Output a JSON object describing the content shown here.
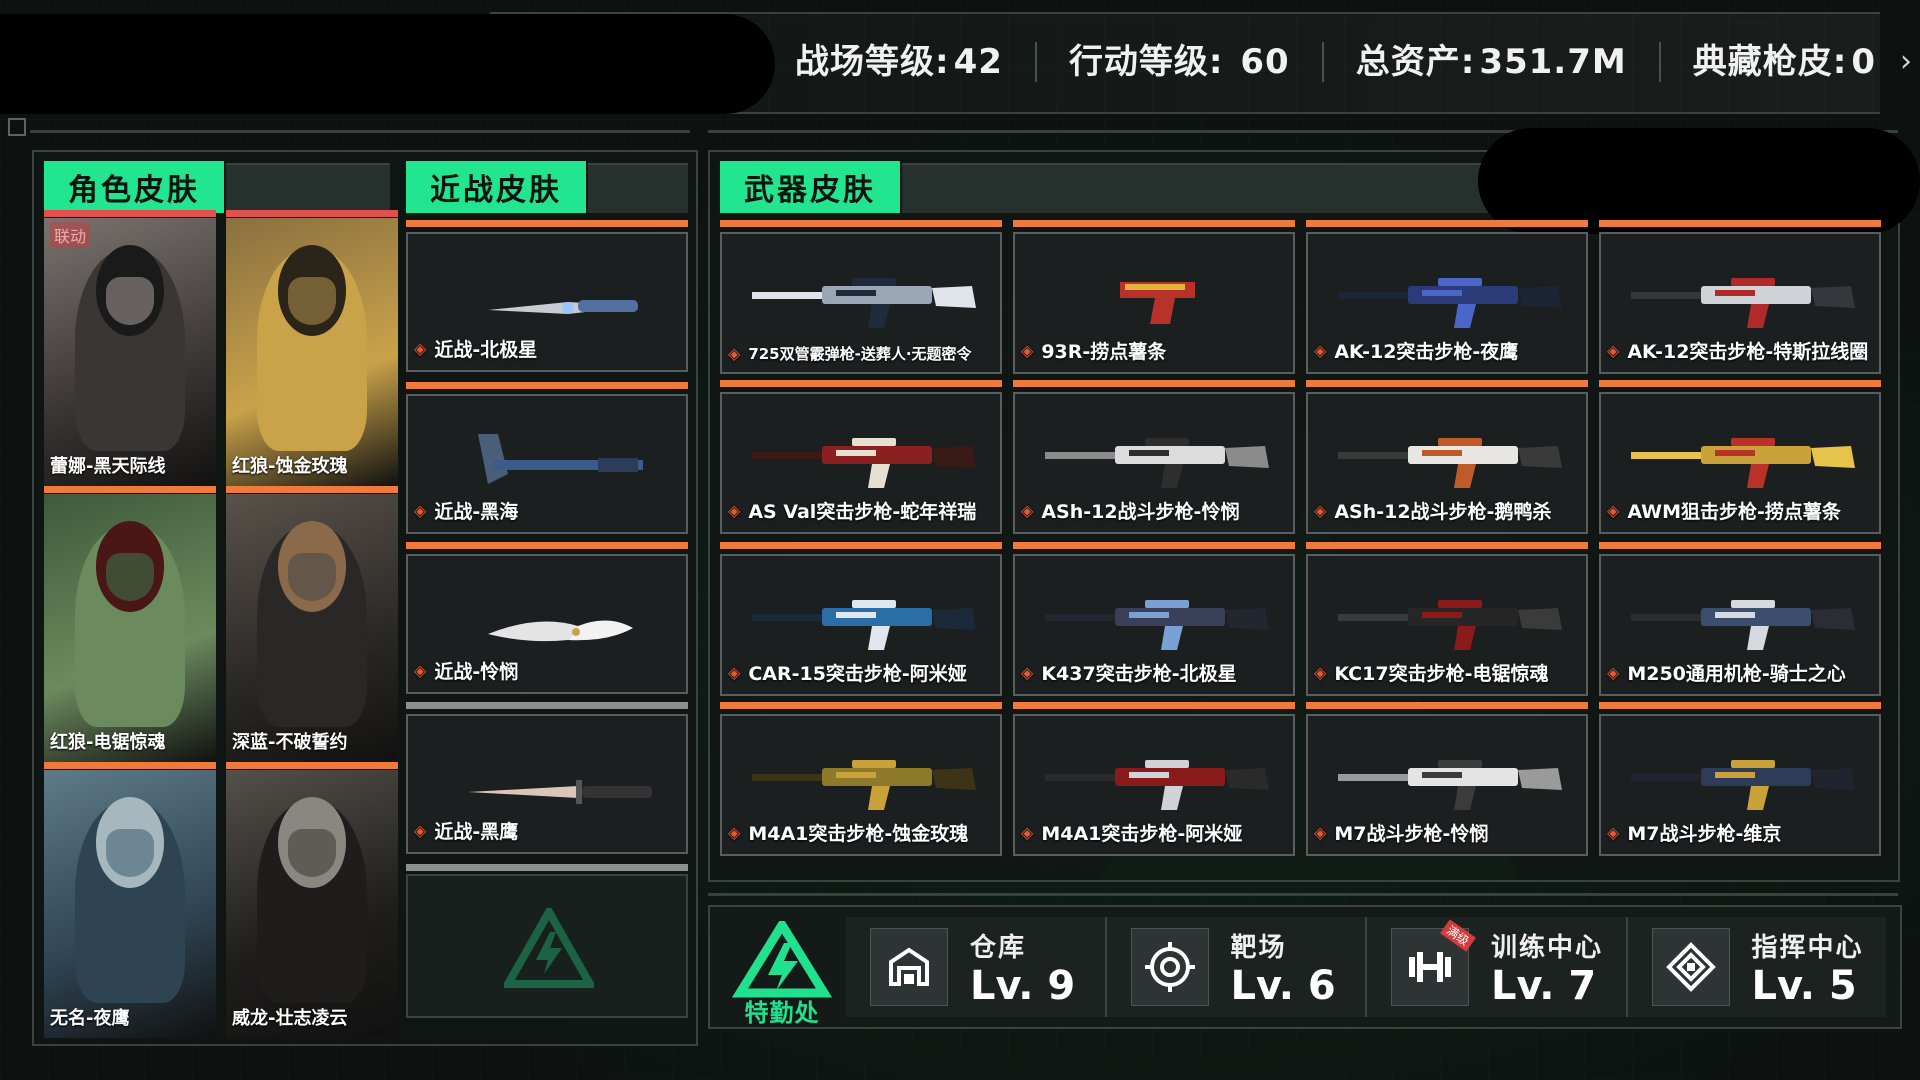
{
  "header": {
    "stats": [
      {
        "label": "战场等级:",
        "value": "42"
      },
      {
        "label": "行动等级: ",
        "value": "60"
      },
      {
        "label": "总资产:",
        "value": "351.7M"
      },
      {
        "label": "典藏枪皮:",
        "value": "0"
      }
    ]
  },
  "tabs": {
    "character": "角色皮肤",
    "melee": "近战皮肤",
    "weapon": "武器皮肤"
  },
  "character_skins": [
    {
      "name": "蕾娜-黑天际线",
      "badge": "联动"
    },
    {
      "name": "红狼-蚀金玫瑰"
    },
    {
      "name": "红狼-电锯惊魂"
    },
    {
      "name": "深蓝-不破誓约"
    },
    {
      "name": "无名-夜鹰"
    },
    {
      "name": "威龙-壮志凌云"
    }
  ],
  "melee_skins": [
    {
      "name": "近战-北极星"
    },
    {
      "name": "近战-黑海"
    },
    {
      "name": "近战-怜悯"
    },
    {
      "name": "近战-黑鹰"
    }
  ],
  "weapon_skins": [
    {
      "name": "725双管霰弹枪-送葬人·无题密令"
    },
    {
      "name": "93R-捞点薯条"
    },
    {
      "name": "AK-12突击步枪-夜鹰"
    },
    {
      "name": "AK-12突击步枪-特斯拉线圈"
    },
    {
      "name": "AS Val突击步枪-蛇年祥瑞"
    },
    {
      "name": "ASh-12战斗步枪-怜悯"
    },
    {
      "name": "ASh-12战斗步枪-鹅鸭杀"
    },
    {
      "name": "AWM狙击步枪-捞点薯条"
    },
    {
      "name": "CAR-15突击步枪-阿米娅"
    },
    {
      "name": "K437突击步枪-北极星"
    },
    {
      "name": "KC17突击步枪-电锯惊魂"
    },
    {
      "name": "M250通用机枪-骑士之心"
    },
    {
      "name": "M4A1突击步枪-蚀金玫瑰"
    },
    {
      "name": "M4A1突击步枪-阿米娅"
    },
    {
      "name": "M7战斗步枪-怜悯"
    },
    {
      "name": "M7战斗步枪-维京"
    }
  ],
  "footer": {
    "logo_label": "特勤处",
    "facilities": [
      {
        "name": "仓库",
        "level": "Lv. 9",
        "icon": "warehouse-icon"
      },
      {
        "name": "靶场",
        "level": "Lv. 6",
        "icon": "target-icon"
      },
      {
        "name": "训练中心",
        "level": "Lv. 7",
        "icon": "dumbbell-icon",
        "badge": "满级"
      },
      {
        "name": "指挥中心",
        "level": "Lv. 5",
        "icon": "command-icon"
      }
    ]
  },
  "colors": {
    "accent": "#21e58f",
    "stripe": "#ee7a3b",
    "rarity_red": "#e35050"
  }
}
